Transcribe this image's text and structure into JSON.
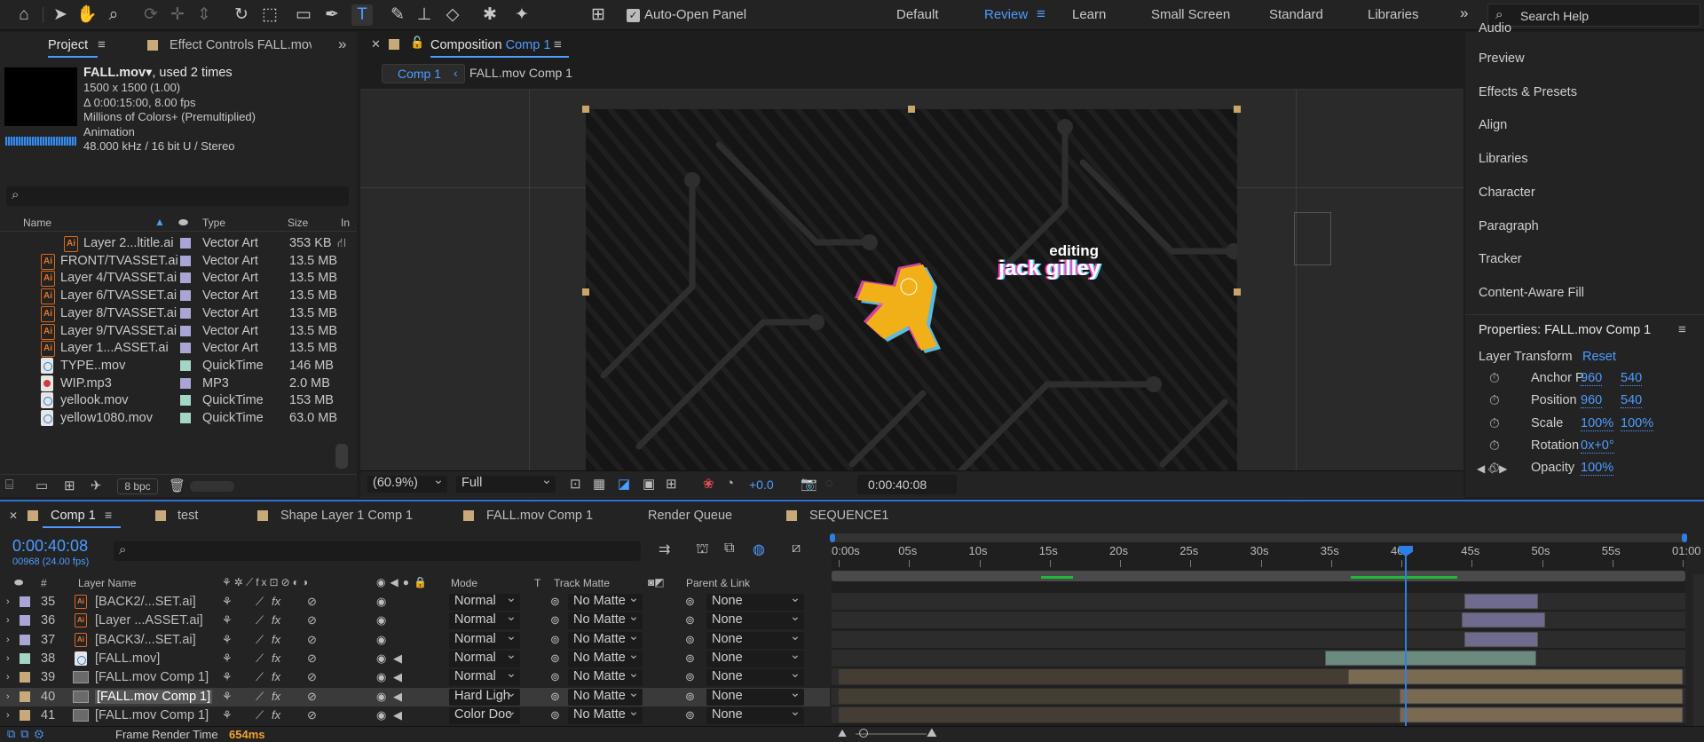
{
  "toolbar": {
    "auto_open_label": "Auto-Open Panel",
    "workspaces": [
      "Default",
      "Review",
      "Learn",
      "Small Screen",
      "Standard",
      "Libraries"
    ],
    "active_workspace": "Review",
    "search_placeholder": "Search Help"
  },
  "project_panel": {
    "tab_project": "Project",
    "tab_effect_controls": "Effect Controls FALL.mov",
    "selected_item": {
      "name": "FALL.mov",
      "used": ", used 2 times",
      "dims": "1500 x 1500 (1.00)",
      "duration": "Δ 0:00:15:00, 8.00 fps",
      "colors": "Millions of Colors+ (Premultiplied)",
      "codec": "Animation",
      "audio": "48.000 kHz / 16 bit U / Stereo"
    },
    "columns": {
      "name": "Name",
      "type": "Type",
      "size": "Size",
      "in": "In"
    },
    "items": [
      {
        "name": "Layer 2...ltitle.ai",
        "type": "Vector Art",
        "size": "353 KB",
        "kind": "ai",
        "indent": true,
        "color": "#a9a6d6"
      },
      {
        "name": "FRONT/TVASSET.ai",
        "type": "Vector Art",
        "size": "13.5 MB",
        "kind": "ai",
        "indent": false,
        "color": "#a9a6d6"
      },
      {
        "name": "Layer 4/TVASSET.ai",
        "type": "Vector Art",
        "size": "13.5 MB",
        "kind": "ai",
        "indent": false,
        "color": "#a9a6d6"
      },
      {
        "name": "Layer 6/TVASSET.ai",
        "type": "Vector Art",
        "size": "13.5 MB",
        "kind": "ai",
        "indent": false,
        "color": "#a9a6d6"
      },
      {
        "name": "Layer 8/TVASSET.ai",
        "type": "Vector Art",
        "size": "13.5 MB",
        "kind": "ai",
        "indent": false,
        "color": "#a9a6d6"
      },
      {
        "name": "Layer 9/TVASSET.ai",
        "type": "Vector Art",
        "size": "13.5 MB",
        "kind": "ai",
        "indent": false,
        "color": "#a9a6d6"
      },
      {
        "name": "Layer 1...ASSET.ai",
        "type": "Vector Art",
        "size": "13.5 MB",
        "kind": "ai",
        "indent": false,
        "color": "#a9a6d6"
      },
      {
        "name": "TYPE..mov",
        "type": "QuickTime",
        "size": "146 MB",
        "kind": "qt",
        "indent": false,
        "color": "#a3d6c4"
      },
      {
        "name": "WIP.mp3",
        "type": "MP3",
        "size": "2.0 MB",
        "kind": "mp",
        "indent": false,
        "color": "#a9a6d6"
      },
      {
        "name": "yellook.mov",
        "type": "QuickTime",
        "size": "153 MB",
        "kind": "qt",
        "indent": false,
        "color": "#a3d6c4"
      },
      {
        "name": "yellow1080.mov",
        "type": "QuickTime",
        "size": "63.0 MB",
        "kind": "qt",
        "indent": false,
        "color": "#a3d6c4"
      }
    ],
    "bpc": "8 bpc"
  },
  "comp_panel": {
    "tab_label": "Composition",
    "tab_comp": "Comp 1",
    "crumbs": [
      "Comp 1",
      "FALL.mov Comp 1"
    ],
    "overlay_small": "editing",
    "overlay_big": "jack gilley",
    "zoom": "(60.9%)",
    "resolution": "Full",
    "exposure": "+0.0",
    "timecode": "0:00:40:08"
  },
  "right_panel": {
    "items": [
      "Audio",
      "Preview",
      "Effects & Presets",
      "Align",
      "Libraries",
      "Character",
      "Paragraph",
      "Tracker",
      "Content-Aware Fill"
    ],
    "properties_title": "Properties: FALL.mov Comp 1",
    "layer_transform": "Layer Transform",
    "reset": "Reset",
    "props": [
      {
        "label": "Anchor P.",
        "v1": "960",
        "v2": "540"
      },
      {
        "label": "Position",
        "v1": "960",
        "v2": "540"
      },
      {
        "label": "Scale",
        "v1": "100%",
        "v2": "100%"
      },
      {
        "label": "Rotation",
        "v1": "0x+0°",
        "v2": ""
      },
      {
        "label": "Opacity",
        "v1": "100%",
        "v2": ""
      }
    ]
  },
  "timeline": {
    "tabs": [
      "Comp 1",
      "test",
      "Shape Layer 1 Comp 1",
      "FALL.mov Comp 1",
      "Render Queue",
      "SEQUENCE1"
    ],
    "timecode": "0:00:40:08",
    "frames": "00968 (24.00 fps)",
    "cols": {
      "num": "#",
      "layer_name": "Layer Name",
      "mode": "Mode",
      "t": "T",
      "track_matte": "Track Matte",
      "parent": "Parent & Link"
    },
    "ruler": [
      "0:00s",
      "05s",
      "10s",
      "15s",
      "20s",
      "25s",
      "30s",
      "35s",
      "40s",
      "45s",
      "50s",
      "55s",
      "01:00"
    ],
    "layers": [
      {
        "num": "35",
        "name": "[BACK2/...SET.ai]",
        "mode": "Normal",
        "matte": "No Matte",
        "parent": "None",
        "color": "#a9a6d6",
        "kind": "ai",
        "start": 44.5,
        "end": 49.7
      },
      {
        "num": "36",
        "name": "[Layer ...ASSET.ai]",
        "mode": "Normal",
        "matte": "No Matte",
        "parent": "None",
        "color": "#a9a6d6",
        "kind": "ai",
        "start": 44.3,
        "end": 50.2
      },
      {
        "num": "37",
        "name": "[BACK3/...SET.ai]",
        "mode": "Normal",
        "matte": "No Matte",
        "parent": "None",
        "color": "#a9a6d6",
        "kind": "ai",
        "start": 44.5,
        "end": 49.7
      },
      {
        "num": "38",
        "name": "[FALL.mov]",
        "mode": "Normal",
        "matte": "No Matte",
        "parent": "None",
        "color": "#a3d6c4",
        "kind": "qt",
        "start": 34.6,
        "end": 49.6
      },
      {
        "num": "39",
        "name": "[FALL.mov Comp 1]",
        "mode": "Normal",
        "matte": "No Matte",
        "parent": "None",
        "color": "#c8a97a",
        "kind": "comp",
        "start": 36.2,
        "end": 60
      },
      {
        "num": "40",
        "name": "[FALL.mov Comp 1]",
        "mode": "Hard Ligh",
        "matte": "No Matte",
        "parent": "None",
        "color": "#c8a97a",
        "kind": "comp",
        "start": 39.9,
        "end": 60
      },
      {
        "num": "41",
        "name": "[FALL.mov Comp 1]",
        "mode": "Color Doc",
        "matte": "No Matte",
        "parent": "None",
        "color": "#c8a97a",
        "kind": "comp",
        "start": 39.9,
        "end": 60
      }
    ],
    "frame_render_label": "Frame Render Time",
    "frame_render_value": "654ms"
  }
}
